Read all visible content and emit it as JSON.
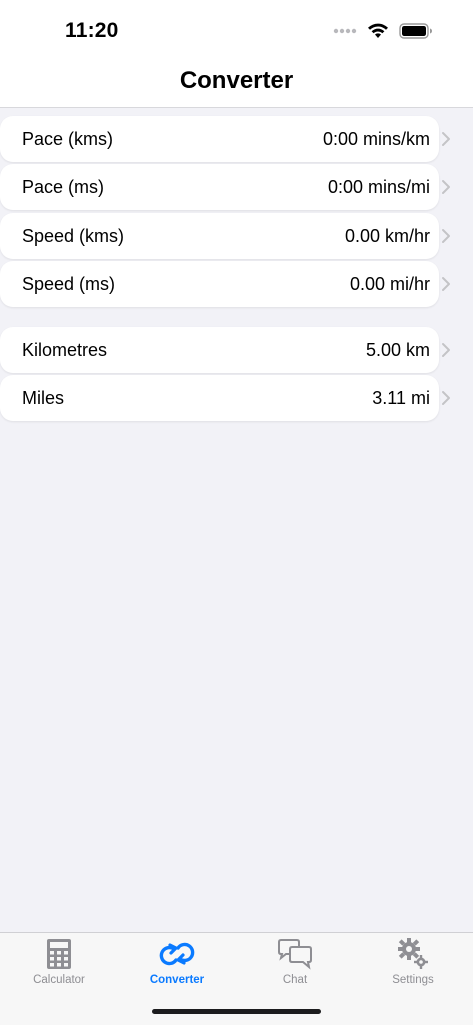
{
  "status_bar": {
    "time": "11:20"
  },
  "nav": {
    "title": "Converter"
  },
  "sections": [
    {
      "rows": [
        {
          "label": "Pace (kms)",
          "value": "0:00 mins/km"
        },
        {
          "label": "Pace (ms)",
          "value": "0:00 mins/mi"
        },
        {
          "label": "Speed (kms)",
          "value": "0.00 km/hr"
        },
        {
          "label": "Speed (ms)",
          "value": "0.00 mi/hr"
        }
      ]
    },
    {
      "rows": [
        {
          "label": "Kilometres",
          "value": "5.00 km"
        },
        {
          "label": "Miles",
          "value": "3.11 mi"
        }
      ]
    }
  ],
  "tab_bar": {
    "selected": "Converter",
    "tabs": [
      {
        "label": "Calculator",
        "icon": "calculator-icon"
      },
      {
        "label": "Converter",
        "icon": "convert-arrows-icon"
      },
      {
        "label": "Chat",
        "icon": "chat-bubbles-icon"
      },
      {
        "label": "Settings",
        "icon": "gears-icon"
      }
    ]
  },
  "colors": {
    "accent": "#0a7aff",
    "background": "#f2f2f7",
    "inactive_tab": "#8e8e93"
  }
}
